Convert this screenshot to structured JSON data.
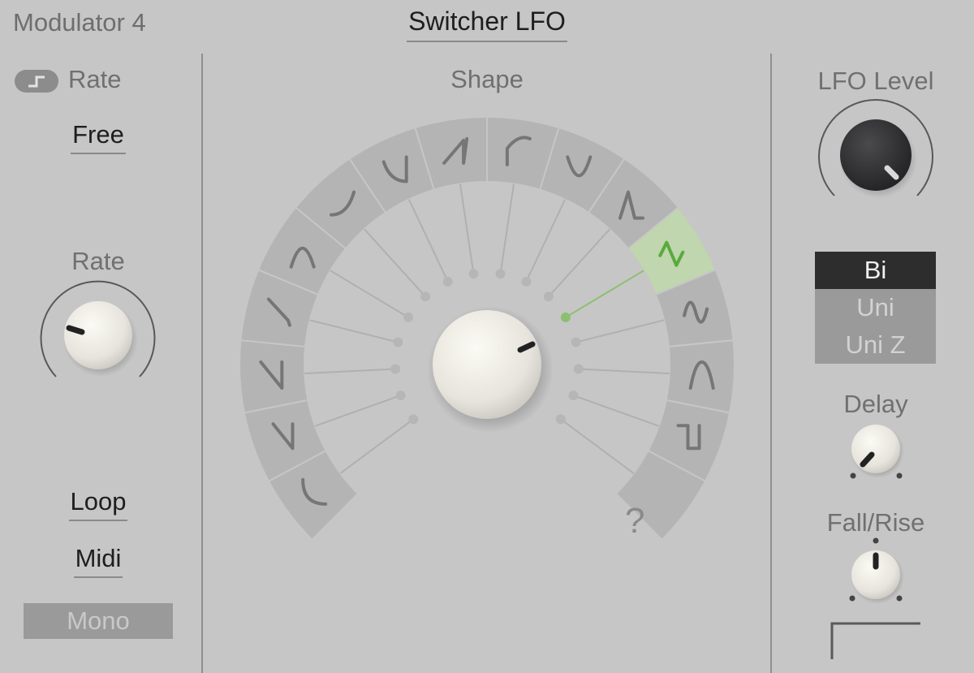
{
  "header": {
    "module": "Modulator 4",
    "device": "Switcher LFO"
  },
  "left": {
    "rate_mode_label": "Rate",
    "rate_menu": "Free",
    "rate_knob_label": "Rate",
    "loop_menu": "Loop",
    "midi_menu": "Midi",
    "mono_button": "Mono"
  },
  "center": {
    "shape_label": "Shape",
    "random_label": "?",
    "selected_shape": "triangle",
    "accent_color": "#5aaa3c"
  },
  "right": {
    "lfo_level_label": "LFO Level",
    "polarity_options": [
      "Bi",
      "Uni",
      "Uni Z"
    ],
    "polarity_selected": "Bi",
    "delay_label": "Delay",
    "fall_rise_label": "Fall/Rise"
  }
}
